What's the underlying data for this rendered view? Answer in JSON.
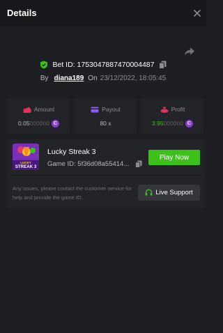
{
  "header": {
    "title": "Details"
  },
  "bet": {
    "label": "Bet ID:",
    "id": "1753047887470004487"
  },
  "byline": {
    "by": "By",
    "user": "diana189",
    "on": "On",
    "timestamp": "23/12/2022, 18:05:45"
  },
  "stats": {
    "amount": {
      "label": "Amount",
      "value_main": "0.05",
      "value_tail": "000000"
    },
    "payout": {
      "label": "Payout",
      "value": "80 x"
    },
    "profit": {
      "label": "Profit",
      "value_main": "3.95",
      "value_tail": "000000"
    }
  },
  "coin_symbol": "C",
  "game": {
    "thumb_line1": "LUCKY",
    "thumb_line2": "STREAK 3",
    "name": "Lucky Streak 3",
    "id_label": "Game ID:",
    "id_value": "5f36d08a55414...",
    "play_label": "Play Now",
    "info_text": "Any issues, please contact the customer service for help and provide the game ID.",
    "support_label": "Live Support"
  },
  "icons": {
    "close": "close-icon",
    "share": "share-icon",
    "shield": "shield-check-icon",
    "copy": "copy-icon",
    "amount": "wallet-icon",
    "payout": "card-icon",
    "profit": "profit-icon",
    "support": "headset-icon"
  },
  "colors": {
    "accent_green": "#3bc117",
    "coin_purple": "#8b3bd6",
    "amount_icon": "#e0315e",
    "payout_icon": "#8b5cf6",
    "profit_icon": "#e0315e"
  }
}
